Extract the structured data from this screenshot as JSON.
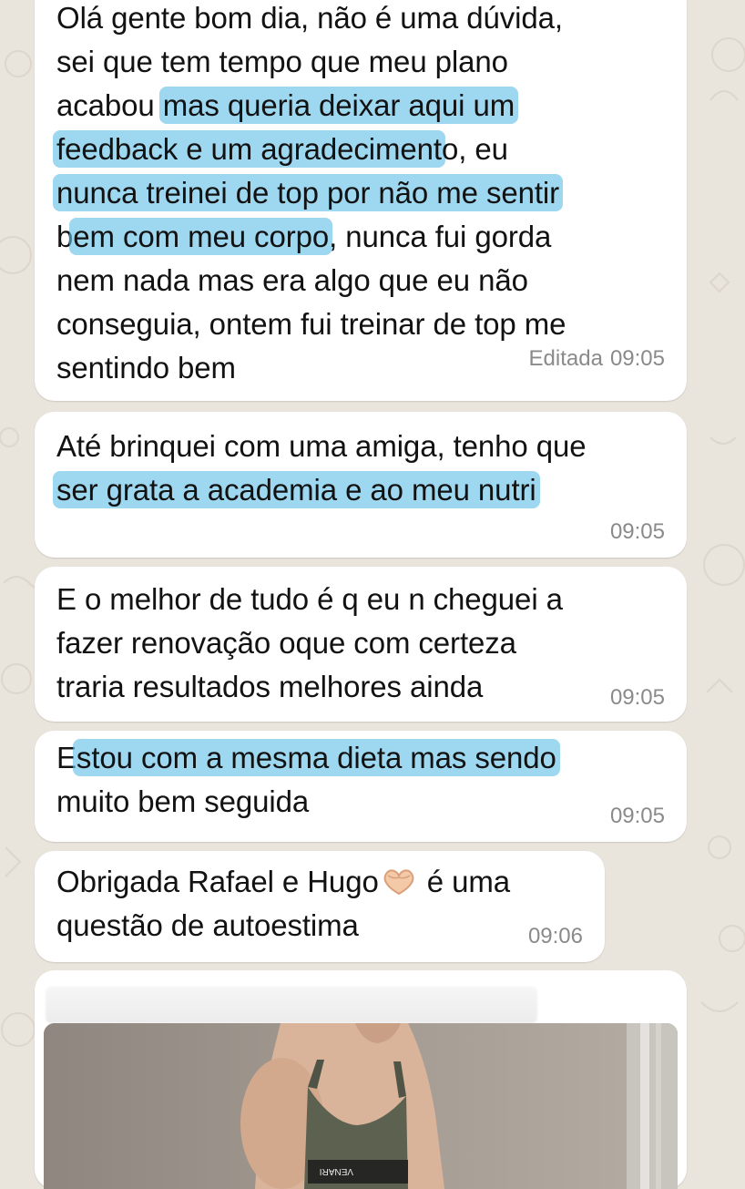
{
  "messages": [
    {
      "lines": [
        [
          {
            "t": "Olá gente bom dia, não é uma dúvida,"
          }
        ],
        [
          {
            "t": "sei que tem tempo que meu plano"
          }
        ],
        [
          {
            "t": "acabou "
          },
          {
            "t": "mas queria deixar aqui um",
            "hl": true
          }
        ],
        [
          {
            "t": "feedback e um agradeciment",
            "hl": true
          },
          {
            "t": "o, eu"
          }
        ],
        [
          {
            "t": "nunca treinei de top por não me sentir",
            "hl": true
          }
        ],
        [
          {
            "t": "b"
          },
          {
            "t": "em com meu corpo",
            "hl": true
          },
          {
            "t": ", nunca fui gorda"
          }
        ],
        [
          {
            "t": "nem nada mas era algo que eu não"
          }
        ],
        [
          {
            "t": "conseguia, ontem fui treinar de top me"
          }
        ],
        [
          {
            "t": "sentindo bem"
          }
        ]
      ],
      "edited_label": "Editada",
      "time": "09:05"
    },
    {
      "lines": [
        [
          {
            "t": "Até brinquei com uma amiga, tenho que"
          }
        ],
        [
          {
            "t": "ser grata a academia e ao meu nutri",
            "hl": true
          }
        ]
      ],
      "time": "09:05"
    },
    {
      "lines": [
        [
          {
            "t": "E o melhor de tudo é q eu n cheguei a"
          }
        ],
        [
          {
            "t": "fazer renovação oque com certeza"
          }
        ],
        [
          {
            "t": "traria resultados melhores ainda"
          }
        ]
      ],
      "time": "09:05"
    },
    {
      "lines": [
        [
          {
            "t": "E"
          },
          {
            "t": "stou com a mesma dieta mas sendo",
            "hl": true
          }
        ],
        [
          {
            "t": "muito bem seguida"
          }
        ]
      ],
      "time": "09:05"
    },
    {
      "lines": [
        [
          {
            "t": "Obrigada Rafael e Hugo"
          },
          {
            "emoji": "heart-hands-icon"
          },
          {
            "t": " é uma"
          }
        ],
        [
          {
            "t": "questão de autoestima"
          }
        ]
      ],
      "time": "09:06"
    }
  ],
  "photo_message": {
    "brand_text": "VENARI"
  },
  "colors": {
    "highlight": "#63bee6",
    "bubble": "#ffffff",
    "wallpaper": "#e9e4dc",
    "meta_text": "#8a8a8a"
  }
}
